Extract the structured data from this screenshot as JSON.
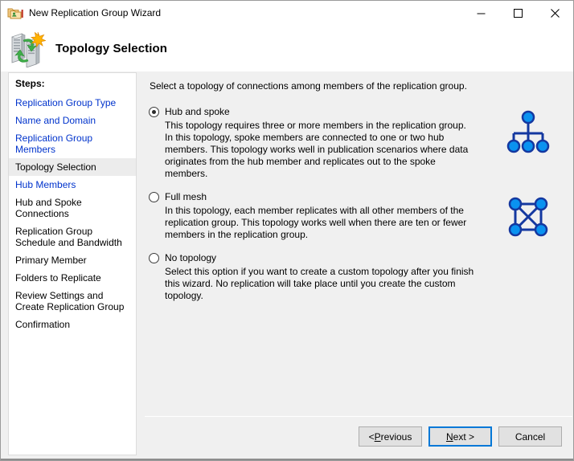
{
  "window": {
    "title": "New Replication Group Wizard",
    "icon": "replication-group-folders-icon",
    "controls": {
      "minimize": "─",
      "maximize": "☐",
      "close": "✕"
    }
  },
  "header": {
    "title": "Topology Selection",
    "icon": "replication-servers-icon"
  },
  "sidebar": {
    "label": "Steps:",
    "items": [
      {
        "label": "Replication Group Type",
        "state": "link"
      },
      {
        "label": "Name and Domain",
        "state": "link"
      },
      {
        "label": "Replication Group Members",
        "state": "link"
      },
      {
        "label": "Topology Selection",
        "state": "current"
      },
      {
        "label": "Hub Members",
        "state": "link"
      },
      {
        "label": "Hub and Spoke Connections",
        "state": "disabled"
      },
      {
        "label": "Replication Group Schedule and Bandwidth",
        "state": "disabled"
      },
      {
        "label": "Primary Member",
        "state": "disabled"
      },
      {
        "label": "Folders to Replicate",
        "state": "disabled"
      },
      {
        "label": "Review Settings and Create Replication Group",
        "state": "disabled"
      },
      {
        "label": "Confirmation",
        "state": "disabled"
      }
    ]
  },
  "content": {
    "intro": "Select a topology of connections among members of the replication group.",
    "options": [
      {
        "label": "Hub and spoke",
        "selected": true,
        "description": "This topology requires three or more members in the replication group. In this topology, spoke members are connected to one or two hub members. This topology works well in publication scenarios where data originates from the hub member and replicates out to the spoke members.",
        "icon": "hub-and-spoke-topology-icon"
      },
      {
        "label": "Full mesh",
        "selected": false,
        "description": "In this topology, each member replicates with all other members of the replication group. This topology works well when there are ten or fewer members in the replication group.",
        "icon": "full-mesh-topology-icon"
      },
      {
        "label": "No topology",
        "selected": false,
        "description": "Select this option if you want to create a custom topology after you finish this wizard. No replication will take place until you create the custom topology.",
        "icon": "none"
      }
    ]
  },
  "footer": {
    "previous": "< Previous",
    "previous_parts": {
      "pre": "< ",
      "accel": "P",
      "post": "revious"
    },
    "next": "Next >",
    "next_parts": {
      "pre": "",
      "accel": "N",
      "post": "ext >"
    },
    "cancel": "Cancel"
  },
  "colors": {
    "accent": "#0078d7",
    "link": "#0033cc",
    "node_fill": "#0a92f0",
    "node_stroke": "#1438a0",
    "panel_bg": "#f0f0f0"
  }
}
